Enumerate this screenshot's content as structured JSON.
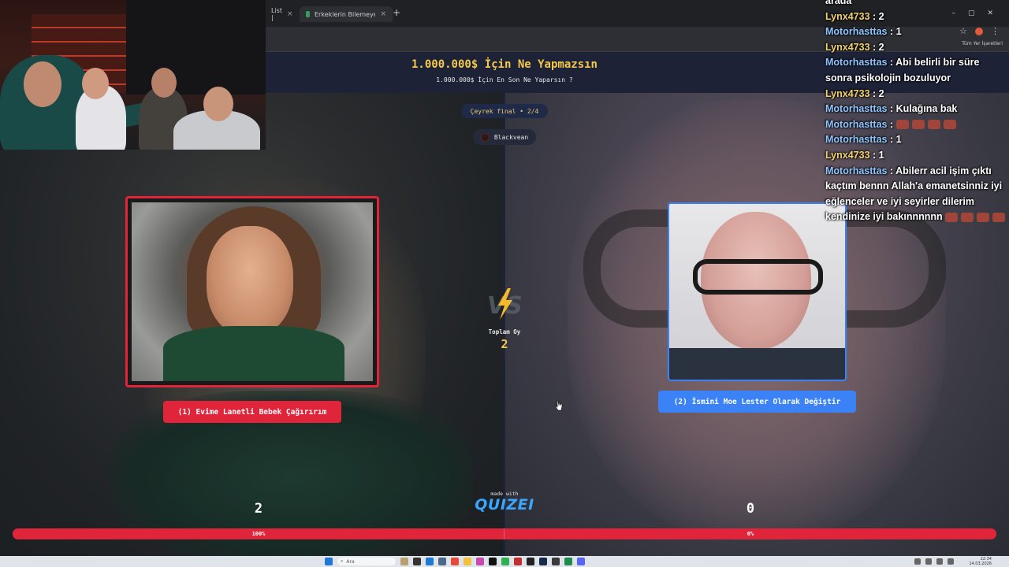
{
  "browser": {
    "tabs": [
      {
        "label": "List |",
        "close": "×"
      },
      {
        "label": "Erkeklerin Bilemeyeceği Şeyler",
        "close": "×"
      }
    ],
    "new_tab": "+",
    "bookmarks_label": "Tüm Yer İşaretleri",
    "window_controls": [
      "–",
      "▢",
      "✕"
    ]
  },
  "quiz": {
    "title": "1.000.000$ İçin Ne Yapmazsın",
    "subtitle": "1.000.000$ İçin En Son Ne Yaparsın ?",
    "round": "Çeyrek final • 2/4",
    "creator": "Blackvean",
    "options": [
      {
        "label": "(1) Evime Lanetli Bebek Çağırırım",
        "score": "2",
        "percent": "100%",
        "color": "#e0243a"
      },
      {
        "label": "(2) İsmini Moe Lester Olarak Değiştir",
        "score": "0",
        "percent": "0%",
        "color": "#3b82f6"
      }
    ],
    "total_label": "Toplam Oy",
    "total_value": "2",
    "made_with": "made with",
    "brand": "QUIZEI",
    "left_share": 1.0
  },
  "chat": {
    "messages": [
      {
        "user": "",
        "text": "arada",
        "type": "text-only"
      },
      {
        "user": "Lynx4733",
        "text": " : 2",
        "type": "lynx"
      },
      {
        "user": "Motorhasttas",
        "text": " : 1",
        "type": "moto"
      },
      {
        "user": "Lynx4733",
        "text": " : 2",
        "type": "lynx"
      },
      {
        "user": "Motorhasttas",
        "text": " : Abi belirli bir süre sonra psikolojin bozuluyor",
        "type": "moto"
      },
      {
        "user": "Lynx4733",
        "text": " : 2",
        "type": "lynx"
      },
      {
        "user": "Motorhasttas",
        "text": " : Kulağına bak",
        "type": "moto"
      },
      {
        "user": "Motorhasttas",
        "text": " : ",
        "type": "moto",
        "emotes": 4
      },
      {
        "user": "Motorhasttas",
        "text": " : 1",
        "type": "moto"
      },
      {
        "user": "Lynx4733",
        "text": " : 1",
        "type": "lynx"
      },
      {
        "user": "Motorhasttas",
        "text": " : Abilerr acil işim çıktı kaçtım bennn Allah'a emanetsinniz iyi eğlenceler ve iyi seyirler dilerim kendinize iyi bakınnnnnn",
        "type": "moto",
        "emotes": 4
      }
    ]
  },
  "taskbar": {
    "search_placeholder": "Ara",
    "time": "22:34",
    "date": "14.03.2026"
  },
  "colors": {
    "option1": "#e0243a",
    "option2": "#3b82f6",
    "title": "#f5c84a",
    "brand": "#3aa7ff"
  }
}
